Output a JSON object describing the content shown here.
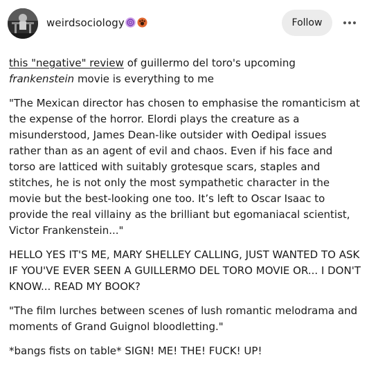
{
  "post": {
    "author": {
      "username": "weirdsociology",
      "badges": [
        "spiral-badge-icon",
        "paw-badge-icon"
      ]
    },
    "follow_label": "Follow",
    "more_icon": "more-dots-icon",
    "intro": {
      "link_text": "this \"negative\" review",
      "text_before_title": " of guillermo del toro's upcoming ",
      "title": "frankenstein",
      "text_after_title": " movie is everything to me"
    },
    "quote1": "\"The Mexican director has chosen to emphasise the romanticism at the expense of the horror. Elordi plays the creature as a misunderstood, James Dean-like outsider with Oedipal issues rather than as an agent of evil and chaos. Even if his face and torso are latticed with suitably grotesque scars, staples and stitches, he is not only the most sympathetic character in the movie but the best-looking one too. It’s left to Oscar Isaac to provide the real villainy as the brilliant but egomaniacal scientist, Victor Frankenstein...\"",
    "caps_paragraph": "HELLO YES IT'S ME, MARY SHELLEY CALLING, JUST WANTED TO ASK IF YOU'VE EVER SEEN A GUILLERMO DEL TORO MOVIE OR... I DON'T KNOW... READ MY BOOK?",
    "quote2": "\"The film lurches between scenes of lush romantic melodrama and moments of Grand Guignol bloodletting.\"",
    "closing": "*bangs fists on table* SIGN! ME! THE! FUCK! UP!"
  },
  "colors": {
    "background": "#ffffff",
    "text": "#1a1a1a",
    "follow_button": "#ececec",
    "badge_spiral": "#b46be0",
    "badge_paw": "#e0672f"
  }
}
